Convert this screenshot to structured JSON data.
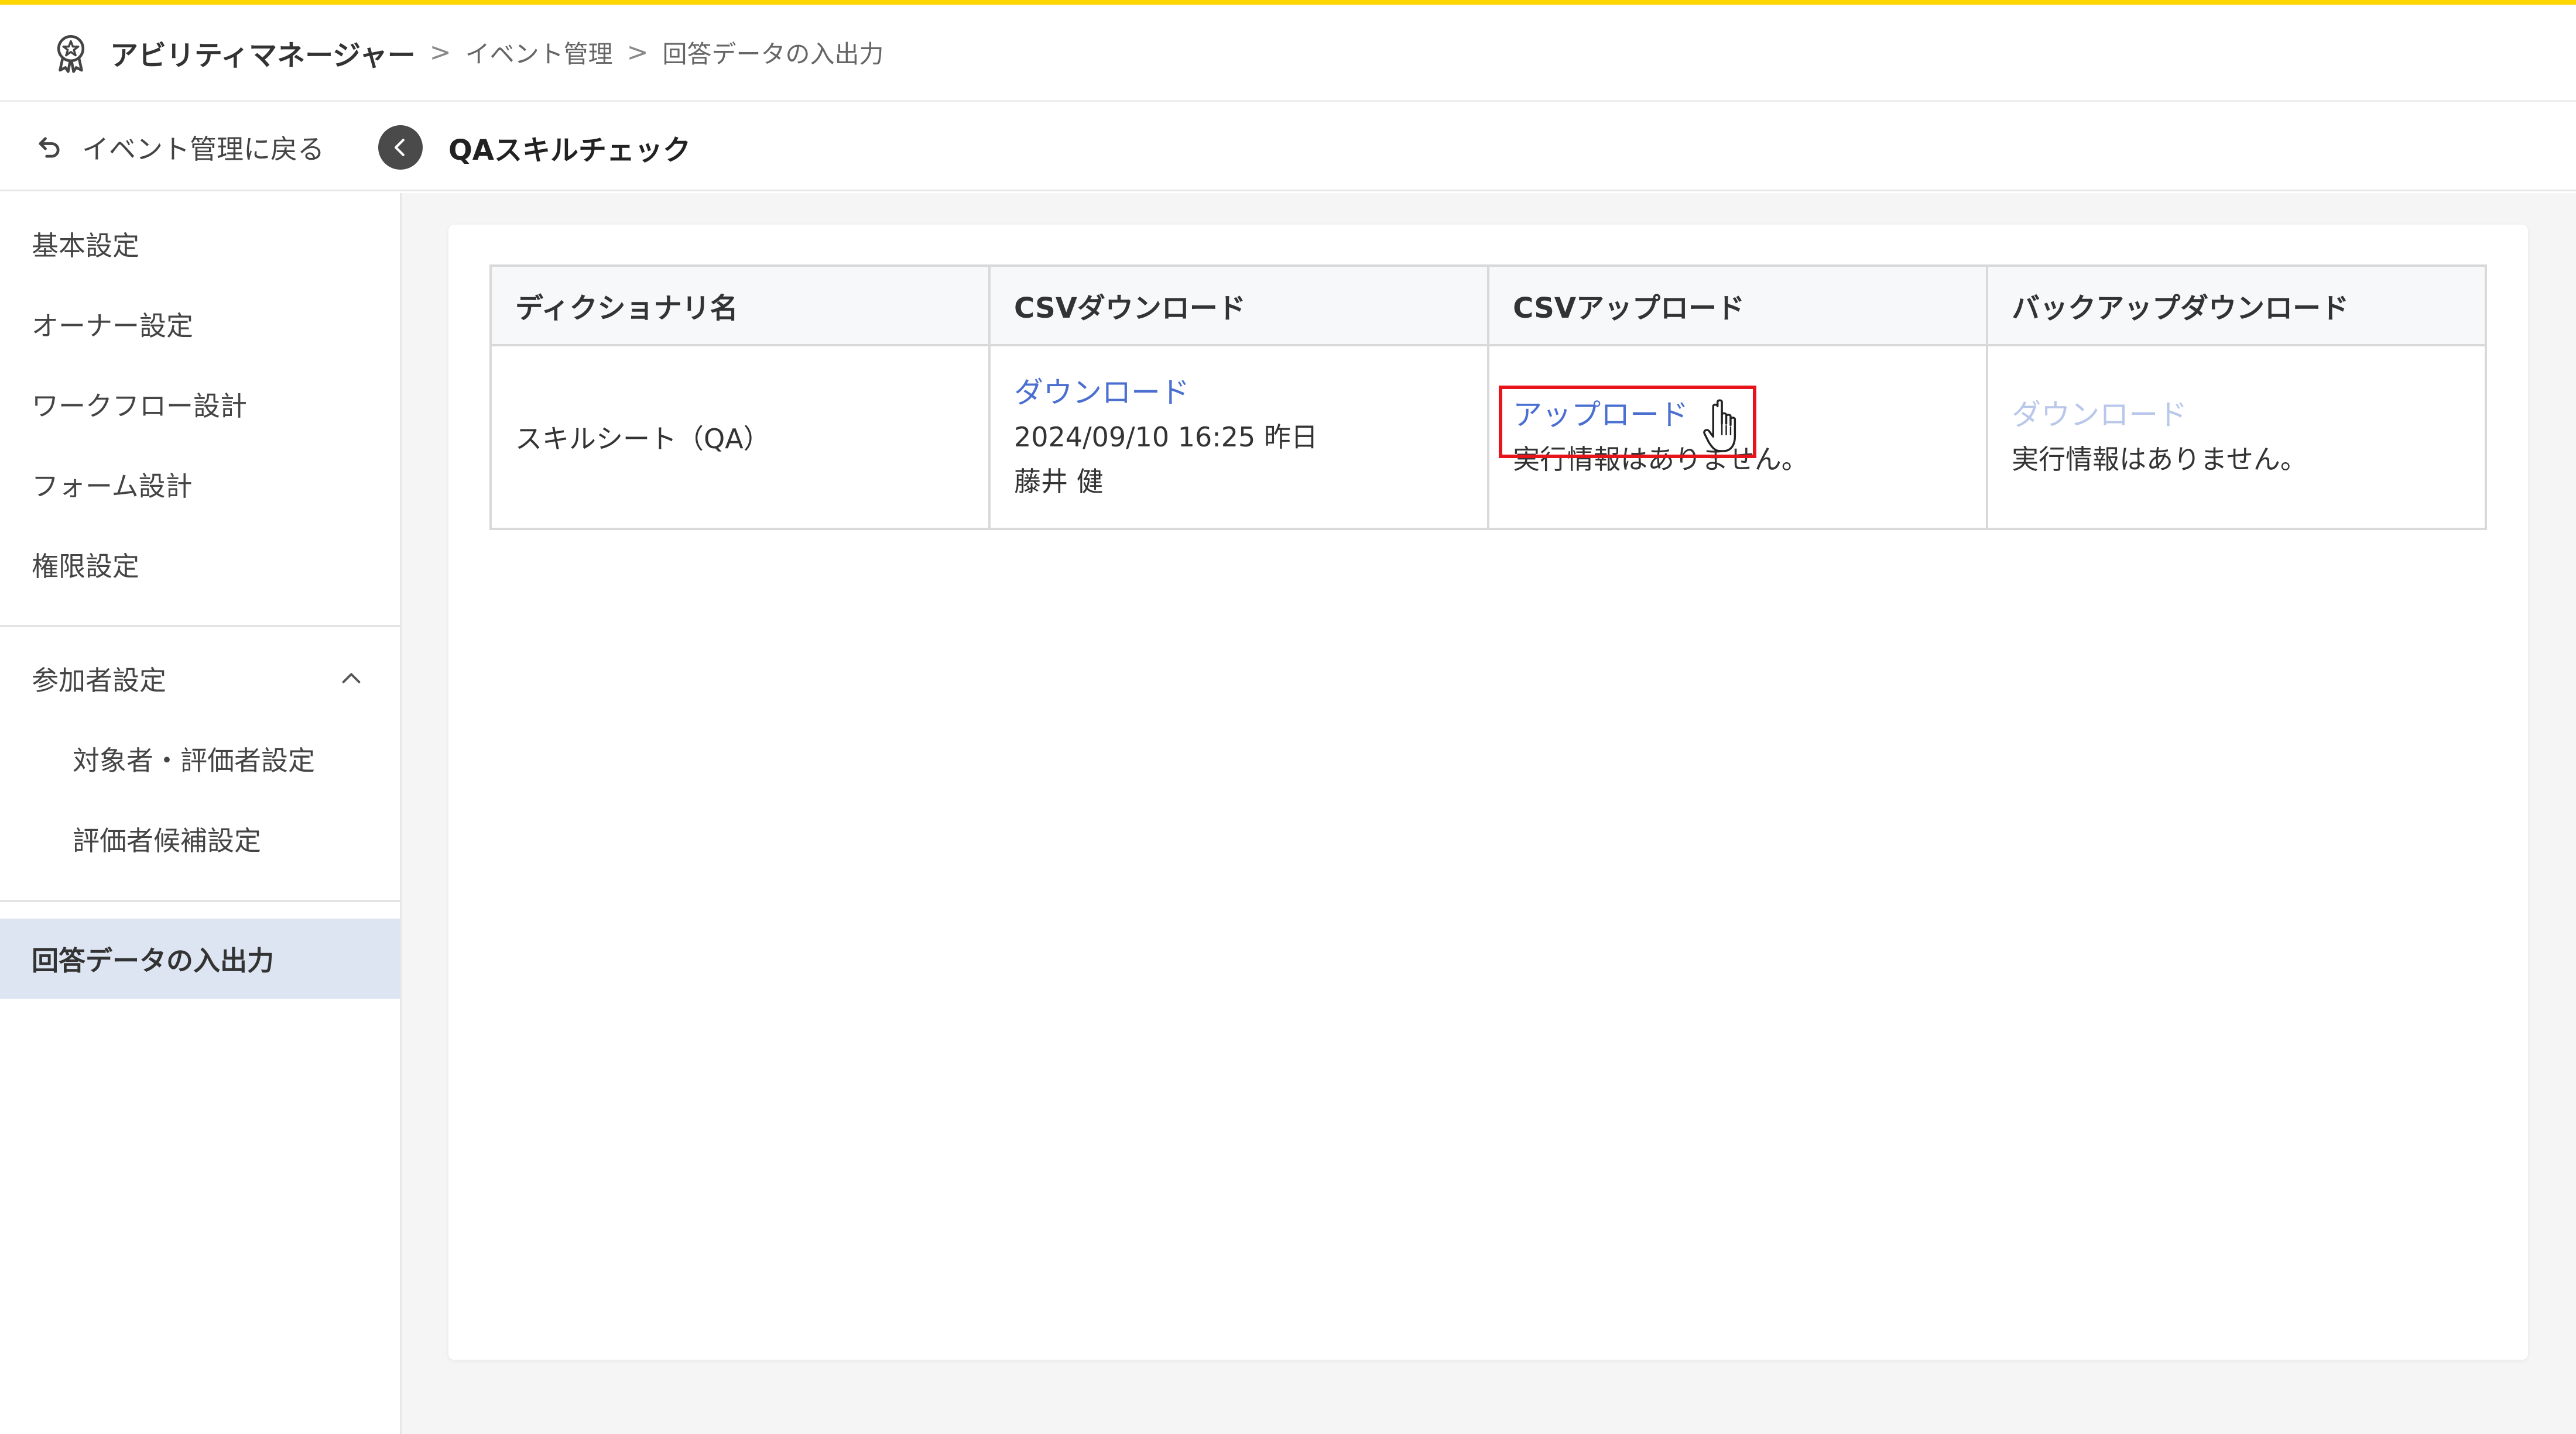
{
  "header": {
    "app_name": "アビリティマネージャー",
    "breadcrumb": [
      "イベント管理",
      "回答データの入出力"
    ],
    "separator": ">",
    "logo_icon": "award-badge-icon",
    "accent_color": "#ffd600"
  },
  "subheader": {
    "back_label": "イベント管理に戻る",
    "back_icon": "undo-arrow-icon",
    "collapse_icon": "chevron-left-icon",
    "event_title": "QAスキルチェック"
  },
  "sidebar": {
    "items": [
      {
        "label": "基本設定"
      },
      {
        "label": "オーナー設定"
      },
      {
        "label": "ワークフロー設計"
      },
      {
        "label": "フォーム設計"
      },
      {
        "label": "権限設定"
      }
    ],
    "participant_group": {
      "label": "参加者設定",
      "toggle_icon": "chevron-up-icon",
      "children": [
        {
          "label": "対象者・評価者設定"
        },
        {
          "label": "評価者候補設定"
        }
      ]
    },
    "active_item": {
      "label": "回答データの入出力"
    }
  },
  "table": {
    "columns": [
      "ディクショナリ名",
      "CSVダウンロード",
      "CSVアップロード",
      "バックアップダウンロード"
    ],
    "rows": [
      {
        "dictionary_name": "スキルシート（QA）",
        "csv_download": {
          "link": "ダウンロード",
          "timestamp": "2024/09/10 16:25 昨日",
          "user": "藤井 健"
        },
        "csv_upload": {
          "link": "アップロード",
          "status": "実行情報はありません。"
        },
        "backup_download": {
          "link": "ダウンロード",
          "status": "実行情報はありません。"
        }
      }
    ]
  },
  "colors": {
    "link": "#4a6fd0",
    "link_disabled": "#b9c8ea",
    "active_nav_bg": "#dde5f2",
    "highlight": "#e8141b"
  }
}
